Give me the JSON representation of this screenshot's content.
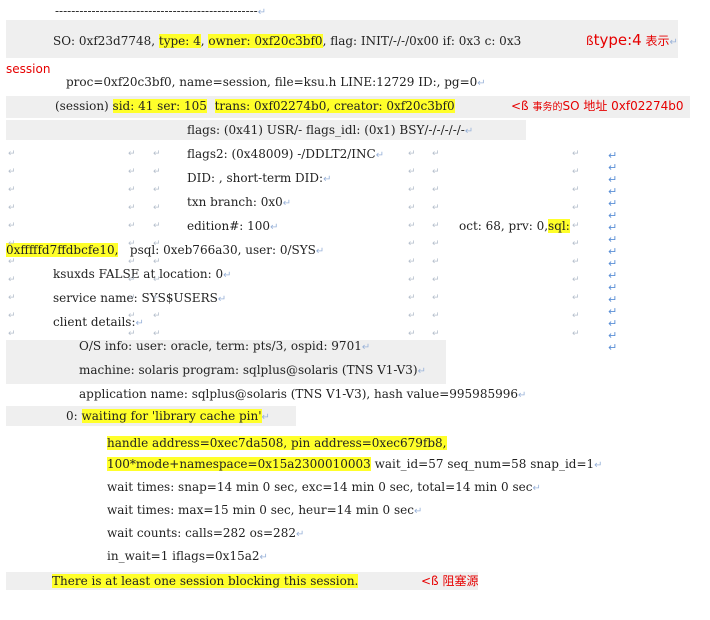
{
  "document": {
    "separator": "--------------------------------------------------",
    "so_line": {
      "prefix": "SO: 0xf23d7748, ",
      "type": "type: 4",
      "comma1": ", ",
      "owner": "owner: 0xf20c3bf0",
      "rest": ", flag: INIT/-/-/0x00 if: 0x3 c: 0x3",
      "note_marker": "ß",
      "note_type": "type",
      "note_colon_val": ":4",
      "note_cn": "表示",
      "note_session": "session"
    },
    "proc_line": "proc=0xf20c3bf0, name=session, file=ksu.h LINE:12729 ID:, pg=0",
    "session_line": {
      "prefix": "(session) ",
      "sid": "sid: 41 ser: 105",
      "trans": "trans: 0xf02274b0",
      "comma": ", ",
      "creator": "creator: 0xf20c3bf0",
      "note_marker": "<ß",
      "note_cn": "事务的",
      "note_rest": "SO 地址 0xf02274b0"
    },
    "flags_line": "flags: (0x41) USR/- flags_idl: (0x1) BSY/-/-/-/-/-",
    "flags2_line": "flags2: (0x48009) -/DDLT2/INC",
    "did_line": "DID: , short-term DID:",
    "txn_line": "txn branch: 0x0",
    "edition_line": {
      "edition": "edition#: 100",
      "oct": "oct: 68, prv: 0,",
      "sql_label": "sql:",
      "sql_addr": "0xfffffd7ffdbcfe10,",
      "psql": "psql: 0xeb766a30, user: 0/SYS"
    },
    "ksuxds_line": "ksuxds FALSE at location: 0",
    "service_line": "service name: SYS$USERS",
    "client_line": "client details:",
    "os_line": "O/S info: user: oracle, term: pts/3, ospid: 9701",
    "machine_line": "machine: solaris program: sqlplus@solaris (TNS V1-V3)",
    "app_line": "application name: sqlplus@solaris (TNS V1-V3), hash value=995985996",
    "waiting_line": {
      "prefix": "0: ",
      "text": "waiting for 'library cache pin'"
    },
    "handle_line": "handle address=0xec7da508, pin address=0xec679fb8,",
    "mode_line": {
      "hl": "100*mode+namespace=0x15a2300010003",
      "rest": " wait_id=57 seq_num=58 snap_id=1"
    },
    "wait_times_1": "wait times: snap=14 min 0 sec, exc=14 min 0 sec, total=14 min 0 sec",
    "wait_times_2": "wait times: max=15 min 0 sec, heur=14 min 0 sec",
    "wait_counts": "wait counts: calls=282 os=282",
    "in_wait": "in_wait=1 iflags=0x15a2",
    "blocking_line": {
      "text": "There is at least one session blocking this session.",
      "note_marker": "<ß",
      "note_cn": "阻塞源"
    },
    "return_mark": "↵"
  },
  "colors": {
    "highlight": "#ffff2a",
    "annotation": "#e60000",
    "shading": "#efefef",
    "para_mark": "#5b8fd6"
  }
}
